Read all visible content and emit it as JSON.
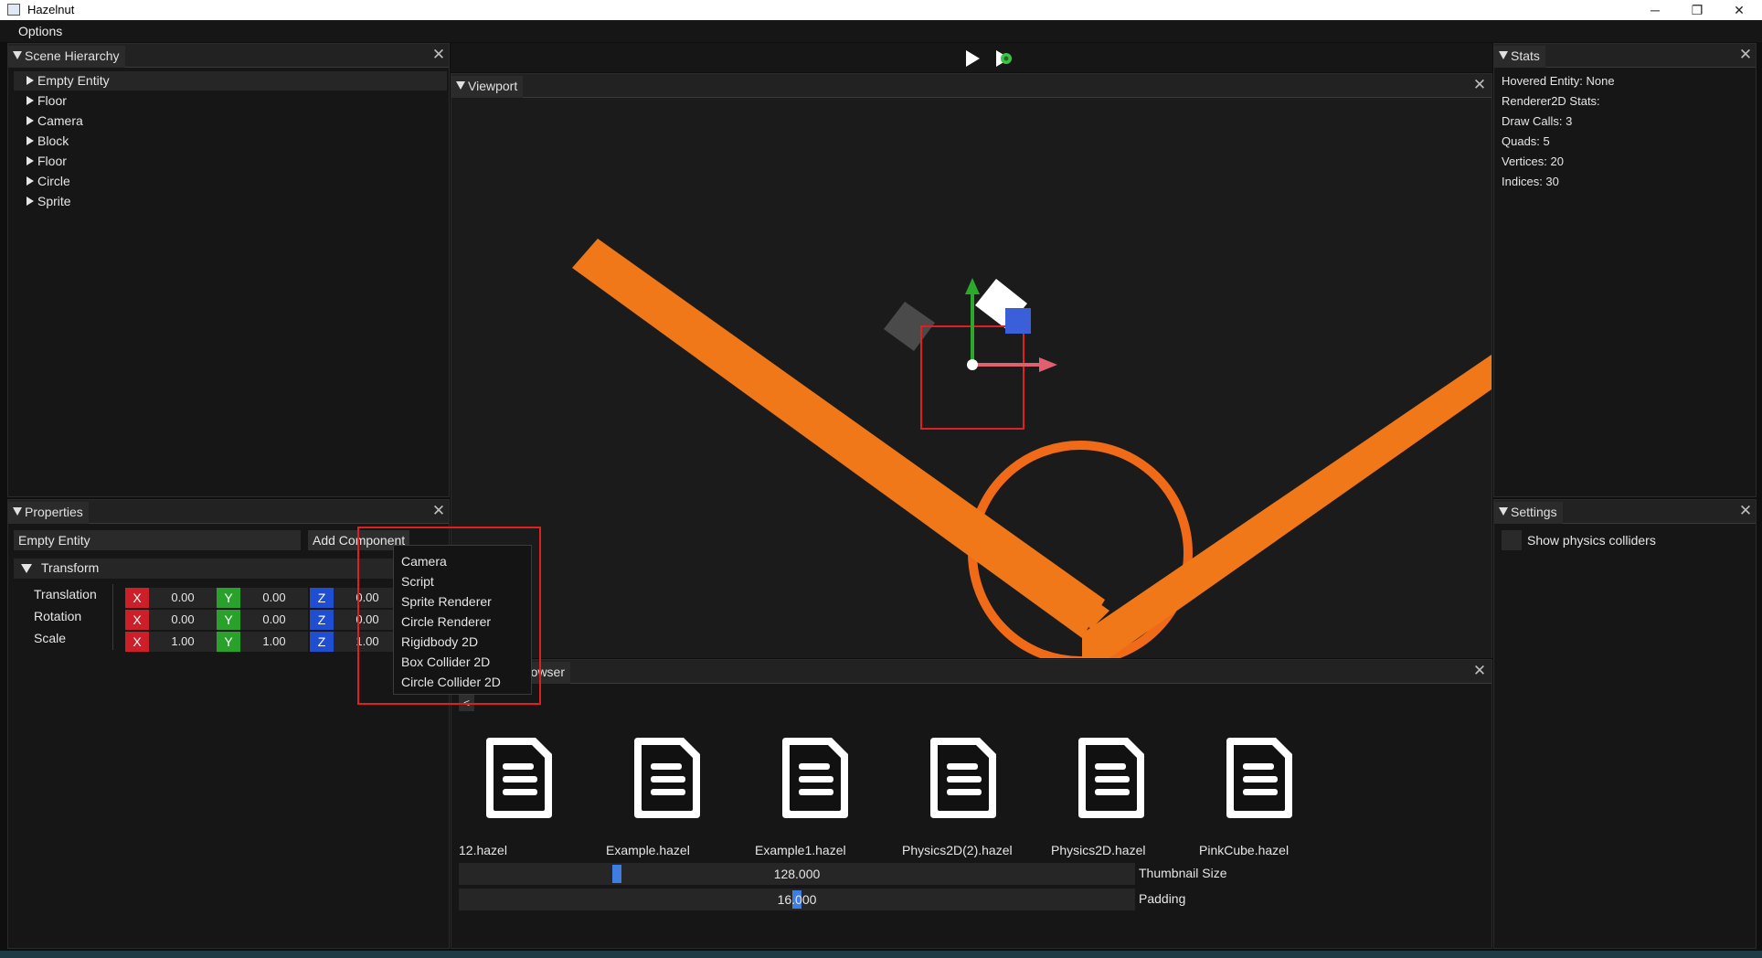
{
  "window": {
    "title": "Hazelnut",
    "minimize": "─",
    "restore": "❐",
    "close": "✕"
  },
  "menu": {
    "options": "Options"
  },
  "scene_hierarchy": {
    "title": "Scene Hierarchy",
    "items": [
      "Empty Entity",
      "Floor",
      "Camera",
      "Block",
      "Floor",
      "Circle",
      "Sprite"
    ]
  },
  "properties": {
    "title": "Properties",
    "entity_name": "Empty Entity",
    "add_component": "Add Component",
    "transform_label": "Transform",
    "rows": [
      {
        "label": "Translation",
        "x": "0.00",
        "y": "0.00",
        "z": "0.00"
      },
      {
        "label": "Rotation",
        "x": "0.00",
        "y": "0.00",
        "z": "0.00"
      },
      {
        "label": "Scale",
        "x": "1.00",
        "y": "1.00",
        "z": "1.00"
      }
    ],
    "axis": {
      "x": "X",
      "y": "Y",
      "z": "Z"
    }
  },
  "add_component_menu": [
    "Camera",
    "Script",
    "Sprite Renderer",
    "Circle Renderer",
    "Rigidbody 2D",
    "Box Collider 2D",
    "Circle Collider 2D"
  ],
  "viewport": {
    "title": "Viewport"
  },
  "toolbar": {
    "play_icon": "play-icon",
    "simulate_icon": "simulate-icon"
  },
  "content_browser": {
    "title_visible": "rowser",
    "back": "<",
    "files": [
      "12.hazel",
      "Example.hazel",
      "Example1.hazel",
      "Physics2D(2).hazel",
      "Physics2D.hazel",
      "PinkCube.hazel"
    ],
    "thumbnail_size": {
      "label": "Thumbnail Size",
      "value": "128.000",
      "fraction": 0.23
    },
    "padding": {
      "label": "Padding",
      "value": "16.000",
      "fraction": 0.5
    }
  },
  "stats": {
    "title": "Stats",
    "lines": [
      "Hovered Entity: None",
      "Renderer2D Stats:",
      "Draw Calls: 3",
      "Quads: 5",
      "Vertices: 20",
      "Indices: 30"
    ]
  },
  "settings": {
    "title": "Settings",
    "show_colliders": "Show physics colliders"
  },
  "colors": {
    "accent": "#3f7de0",
    "orange": "#f07818",
    "x": "#cc1f2a",
    "y": "#2aa12a",
    "z": "#1f4fd0"
  }
}
